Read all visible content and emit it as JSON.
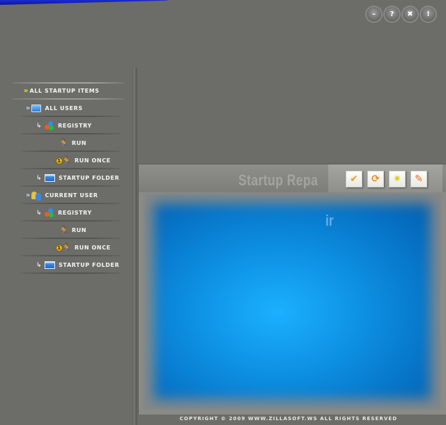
{
  "window": {
    "controls": [
      {
        "name": "minimize-button",
        "icon": "minimize-icon",
        "glyph": "–"
      },
      {
        "name": "help-button",
        "icon": "help-icon",
        "glyph": "?"
      },
      {
        "name": "close-button",
        "icon": "close-icon",
        "glyph": "✖"
      },
      {
        "name": "about-button",
        "icon": "exclamation-icon",
        "glyph": "!"
      }
    ]
  },
  "sidebar": {
    "items": [
      {
        "label": "All Startup Items",
        "icon": "double-chevron-icon",
        "level": 0
      },
      {
        "label": "All Users",
        "icon": "monitor-icon",
        "level": 1
      },
      {
        "label": "Registry",
        "icon": "registry-icon",
        "level": 2
      },
      {
        "label": "Run",
        "icon": "run-icon",
        "level": 3
      },
      {
        "label": "Run Once",
        "icon": "run-once-icon",
        "level": 3
      },
      {
        "label": "Startup Folder",
        "icon": "folder-icon",
        "level": 2
      },
      {
        "label": "Current User",
        "icon": "users-icon",
        "level": 1
      },
      {
        "label": "Registry",
        "icon": "registry-icon",
        "level": 2
      },
      {
        "label": "Run",
        "icon": "run-icon",
        "level": 3
      },
      {
        "label": "Run Once",
        "icon": "run-once-icon",
        "level": 3
      },
      {
        "label": "Startup Folder",
        "icon": "folder-icon",
        "level": 2
      }
    ]
  },
  "panel": {
    "title": "Startup Repa",
    "ghost_text": "ir",
    "toolbar": [
      {
        "name": "apply-button",
        "icon": "checkmark-icon",
        "glyph": "✔",
        "color": "#f0a010"
      },
      {
        "name": "refresh-button",
        "icon": "refresh-icon",
        "glyph": "⟳",
        "color": "#f08a10"
      },
      {
        "name": "new-item-button",
        "icon": "new-document-icon",
        "glyph": "✷",
        "color": "#e8c810"
      },
      {
        "name": "edit-button",
        "icon": "edit-icon",
        "glyph": "✎",
        "color": "#e86a10"
      }
    ]
  },
  "footer": {
    "copyright": "Copyright © 2009 www.zillasoft.ws All Rights Reserved"
  },
  "colors": {
    "background": "#6c6c68",
    "screen_blue": "#0e92e4",
    "accent_yellow": "#e8e820"
  }
}
